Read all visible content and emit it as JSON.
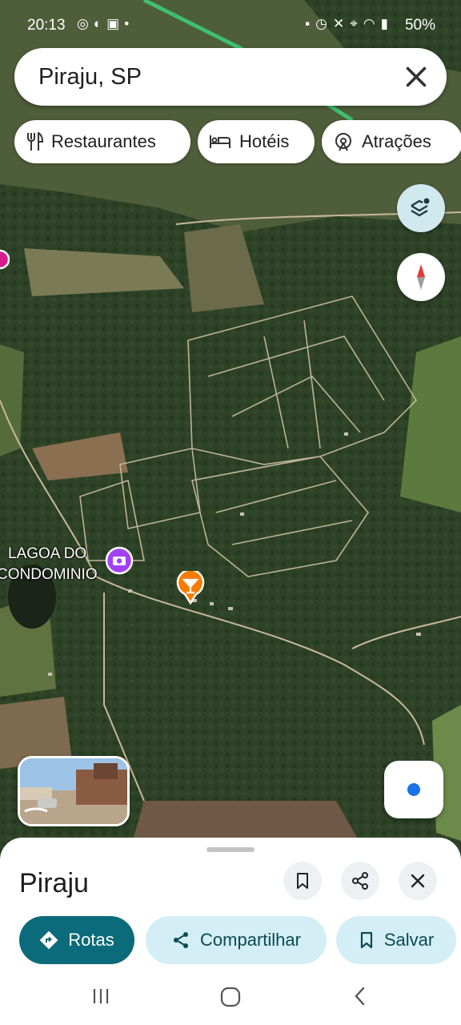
{
  "status_bar": {
    "time": "20:13",
    "left_icons": [
      "instagram-icon",
      "half-moon-icon",
      "gallery-icon",
      "dot-icon"
    ],
    "right_icons": [
      "lock-icon",
      "alarm-icon",
      "mute-icon",
      "location-icon",
      "wifi-icon",
      "signal-icon"
    ],
    "battery": "50%"
  },
  "search": {
    "query": "Piraju, SP"
  },
  "chips": [
    {
      "label": "Restaurantes",
      "icon": "fork-knife-icon"
    },
    {
      "label": "Hotéis",
      "icon": "bed-icon"
    },
    {
      "label": "Atrações",
      "icon": "ferris-wheel-icon"
    }
  ],
  "map": {
    "place_label_line1": "LAGOA DO",
    "place_label_line2": "CONDOMINIO",
    "pins": [
      "camera-pin-icon",
      "cocktail-pin-icon"
    ]
  },
  "sheet": {
    "title": "Piraju",
    "actions": {
      "directions": "Rotas",
      "share": "Compartilhar",
      "save": "Salvar"
    }
  },
  "colors": {
    "primary_button": "#0b6b7a",
    "tonal_button": "#d3eef5",
    "my_location_dot": "#1a73e8",
    "camera_pin": "#a142f4",
    "bar_pin": "#f57c00"
  }
}
